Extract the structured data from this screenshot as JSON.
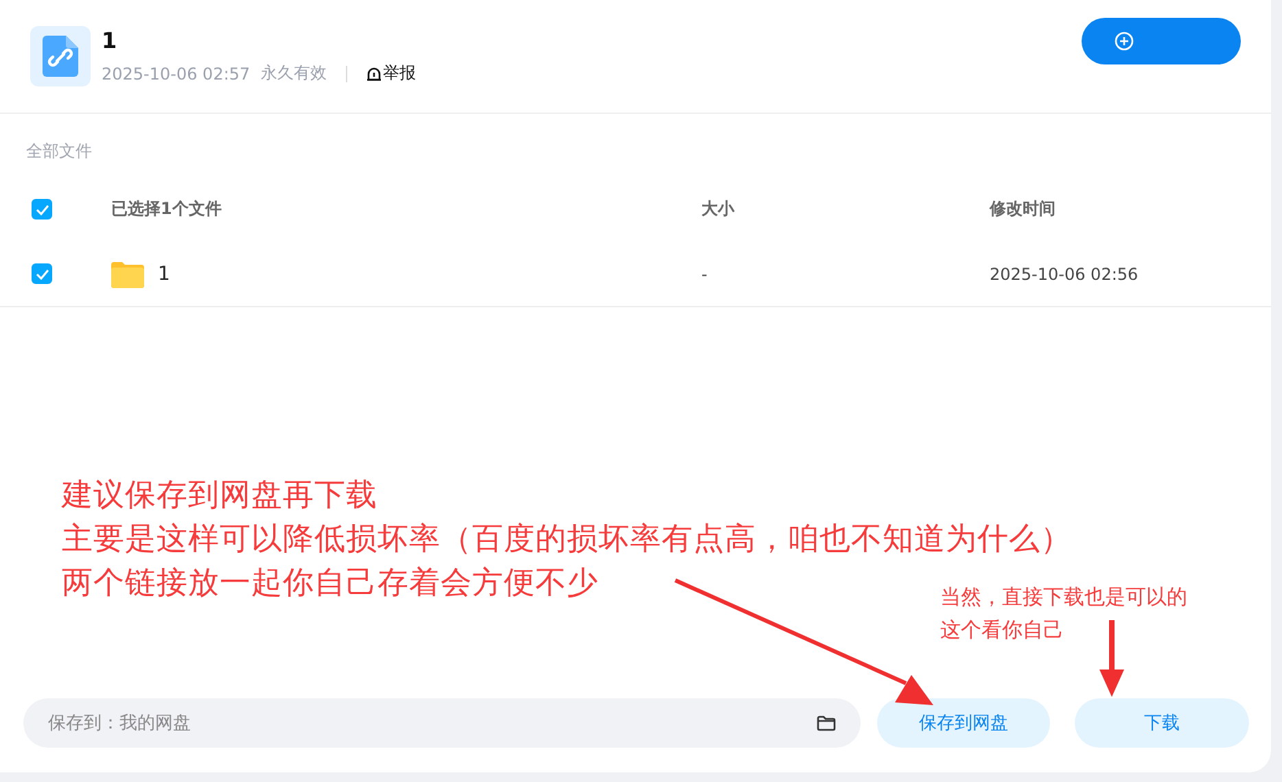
{
  "share": {
    "title": "1",
    "date": "2025-10-06 02:57",
    "validity": "永久有效",
    "report": "举报"
  },
  "breadcrumb": "全部文件",
  "table": {
    "all_selected": true,
    "columns": [
      "已选择1个文件",
      "大小",
      "修改时间"
    ],
    "rows": [
      {
        "name": "1",
        "size": "-",
        "modified": "2025-10-06 02:56",
        "selected": true
      }
    ]
  },
  "save_bar": {
    "path": "保存到：我的网盘",
    "buttons": [
      "保存到网盘",
      "下载"
    ]
  },
  "annotations": [
    {
      "lines": [
        "建议保存到网盘再下载",
        "主要是这样可以降低损坏率（百度的损坏率有点高，咱也不知道为什么）",
        "两个链接放一起你自己存着会方便不少"
      ]
    },
    {
      "lines": [
        "当然，直接下载也是可以的",
        "这个看你自己"
      ]
    }
  ]
}
